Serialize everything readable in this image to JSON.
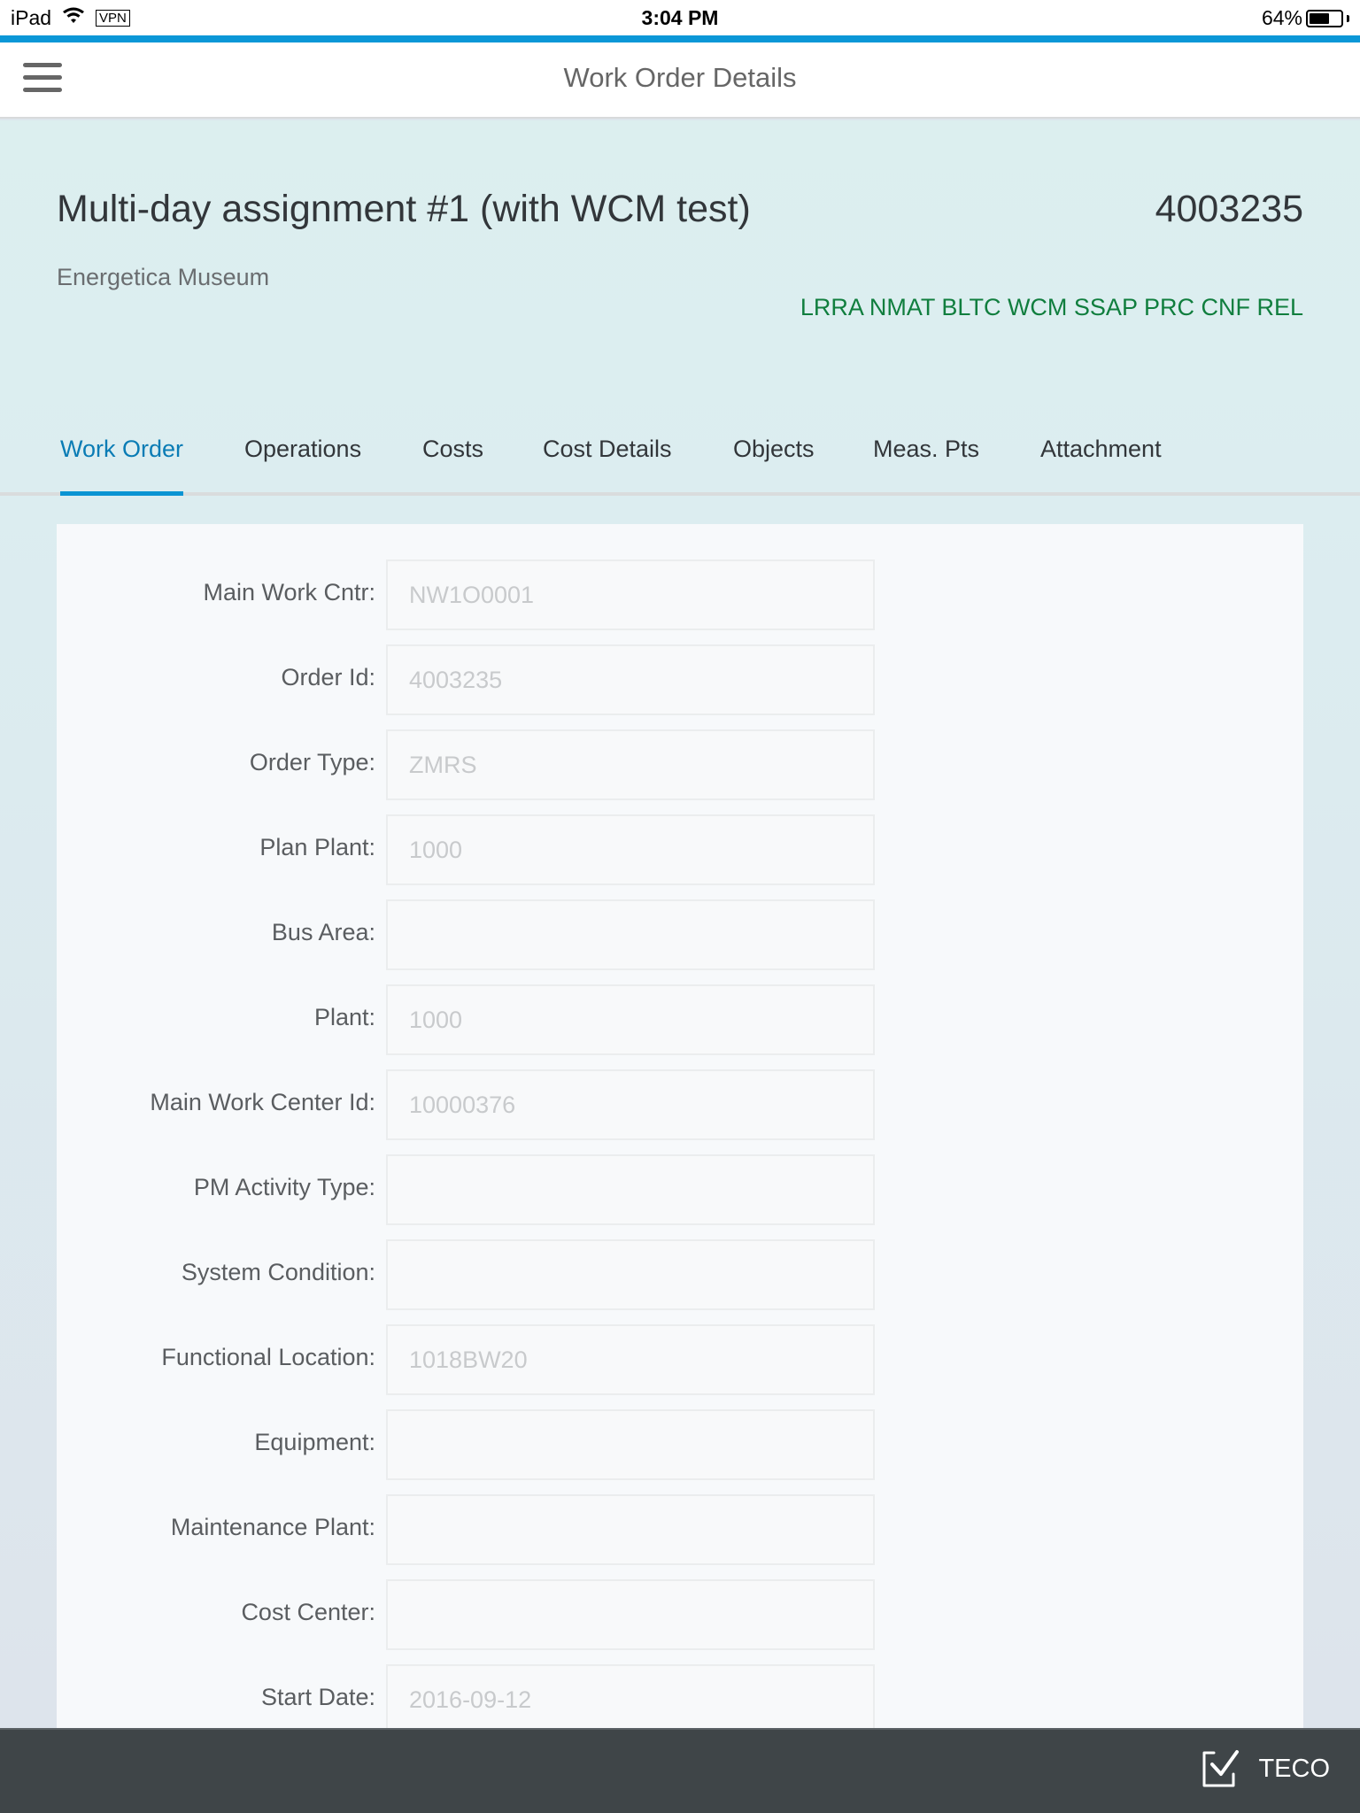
{
  "status_bar": {
    "device": "iPad",
    "vpn_label": "VPN",
    "time": "3:04 PM",
    "battery_percent_label": "64%",
    "battery_level": 0.64
  },
  "nav": {
    "title": "Work Order Details",
    "menu_icon": "hamburger-menu-icon"
  },
  "work_order": {
    "title": "Multi-day assignment #1 (with WCM test)",
    "number": "4003235",
    "location": "Energetica Museum",
    "status_codes": "LRRA NMAT BLTC WCM SSAP PRC CNF REL",
    "status_color": "#107e3e"
  },
  "tabs": [
    {
      "label": "Work Order",
      "active": true
    },
    {
      "label": "Operations",
      "active": false
    },
    {
      "label": "Costs",
      "active": false
    },
    {
      "label": "Cost Details",
      "active": false
    },
    {
      "label": "Objects",
      "active": false
    },
    {
      "label": "Meas. Pts",
      "active": false
    },
    {
      "label": "Attachment",
      "active": false
    }
  ],
  "form": {
    "fields": [
      {
        "label": "Main Work Cntr:",
        "value": "NW1O0001"
      },
      {
        "label": "Order Id:",
        "value": "4003235"
      },
      {
        "label": "Order Type:",
        "value": "ZMRS"
      },
      {
        "label": "Plan Plant:",
        "value": "1000"
      },
      {
        "label": "Bus Area:",
        "value": ""
      },
      {
        "label": "Plant:",
        "value": "1000"
      },
      {
        "label": "Main Work Center Id:",
        "value": "10000376"
      },
      {
        "label": "PM Activity Type:",
        "value": ""
      },
      {
        "label": "System Condition:",
        "value": ""
      },
      {
        "label": "Functional Location:",
        "value": "1018BW20"
      },
      {
        "label": "Equipment:",
        "value": ""
      },
      {
        "label": "Maintenance Plant:",
        "value": ""
      },
      {
        "label": "Cost Center:",
        "value": ""
      },
      {
        "label": "Start Date:",
        "value": "2016-09-12"
      }
    ]
  },
  "footer": {
    "teco_label": "TECO",
    "teco_icon": "checkbox-checked-icon"
  },
  "colors": {
    "accent": "#0b97d7",
    "active_tab": "#0a7cb5",
    "footer_bg": "#3f4548"
  }
}
